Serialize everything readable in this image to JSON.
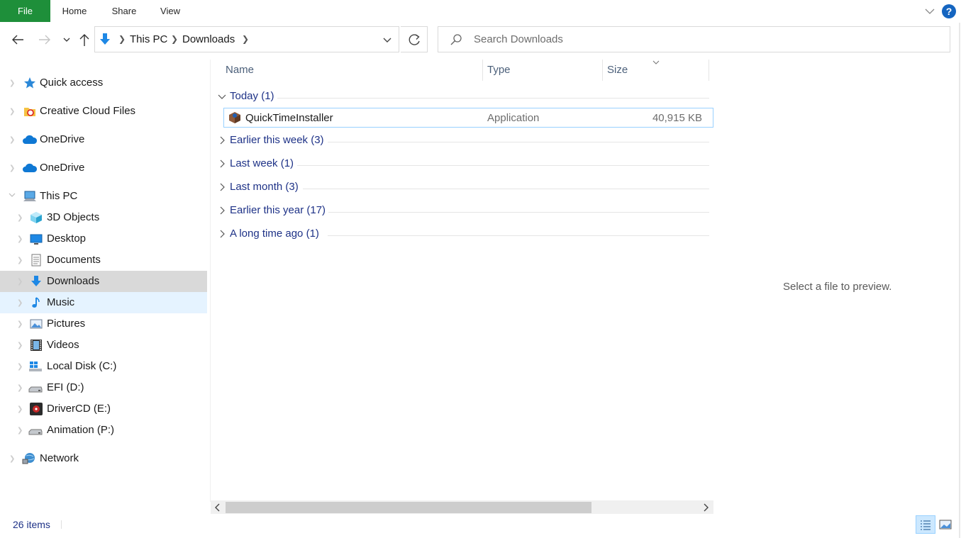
{
  "ribbon": {
    "tabs": [
      "File",
      "Home",
      "Share",
      "View"
    ],
    "help_label": "?"
  },
  "address": {
    "breadcrumbs": [
      "This PC",
      "Downloads"
    ]
  },
  "search": {
    "placeholder": "Search Downloads"
  },
  "nav": {
    "items": [
      {
        "label": "Quick access",
        "icon": "star-icon"
      },
      {
        "label": "Creative Cloud Files",
        "icon": "creative-cloud-icon"
      },
      {
        "label": "OneDrive",
        "icon": "cloud-icon"
      },
      {
        "label": "OneDrive",
        "icon": "cloud-icon"
      },
      {
        "label": "This PC",
        "icon": "computer-icon"
      },
      {
        "label": "3D Objects",
        "icon": "cube-icon"
      },
      {
        "label": "Desktop",
        "icon": "desktop-icon"
      },
      {
        "label": "Documents",
        "icon": "document-icon"
      },
      {
        "label": "Downloads",
        "icon": "download-arrow-icon"
      },
      {
        "label": "Music",
        "icon": "music-note-icon"
      },
      {
        "label": "Pictures",
        "icon": "picture-icon"
      },
      {
        "label": "Videos",
        "icon": "film-icon"
      },
      {
        "label": "Local Disk (C:)",
        "icon": "windows-drive-icon"
      },
      {
        "label": "EFI (D:)",
        "icon": "drive-icon"
      },
      {
        "label": "DriverCD (E:)",
        "icon": "drivercd-icon"
      },
      {
        "label": "Animation (P:)",
        "icon": "drive-icon"
      },
      {
        "label": "Network",
        "icon": "network-icon"
      }
    ]
  },
  "columns": [
    "Name",
    "Type",
    "Size"
  ],
  "groups": [
    {
      "title": "Today (1)",
      "expanded": true
    },
    {
      "title": "Earlier this week (3)",
      "expanded": false
    },
    {
      "title": "Last week (1)",
      "expanded": false
    },
    {
      "title": "Last month (3)",
      "expanded": false
    },
    {
      "title": "Earlier this year (17)",
      "expanded": false
    },
    {
      "title": "A long time ago (1)",
      "expanded": false
    }
  ],
  "file": {
    "name": "QuickTimeInstaller",
    "type": "Application",
    "size": "40,915 KB",
    "icon": "installer-box-icon"
  },
  "preview": {
    "text": "Select a file to preview."
  },
  "status": {
    "count": "26 items"
  },
  "colors": {
    "accent": "#1e8f3a",
    "link": "#1e3287",
    "selection": "#cce8ff"
  }
}
